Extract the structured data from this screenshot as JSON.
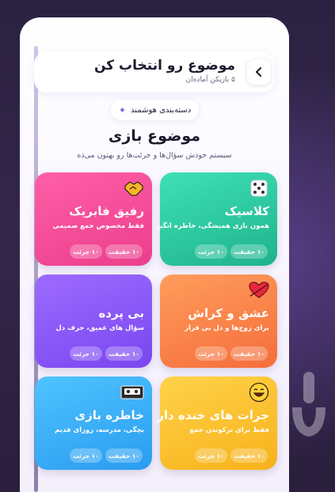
{
  "header": {
    "title": "موضوع رو انتخاب کن",
    "subtitle": "۵ بازیکن آماده‌ان"
  },
  "smart_category": {
    "label": "دسته‌بندی هوشمند"
  },
  "section": {
    "title": "موضوع بازی",
    "subtitle": "سیستم خودش سؤال‌ها و جرئت‌ها رو بهتون می‌ده"
  },
  "cards": [
    {
      "title": "کلاسیک",
      "desc": "همون بازی همیشگی، خاطره انگیز",
      "truth": "۱۰ حقیقت",
      "dare": "۱۰ جرئت",
      "icon": "dice-icon",
      "color_from": "#3fe0b5",
      "color_to": "#1fb38d"
    },
    {
      "title": "رفیق فابریک",
      "desc": "فقط مخصوص جمع صمیمی",
      "truth": "۱۰ حقیقت",
      "dare": "۱۰ جرئت",
      "icon": "handshake-icon",
      "color_from": "#ff5fa8",
      "color_to": "#ec3e8c"
    },
    {
      "title": "عشق و کراش",
      "desc": "برای زوج‌ها و دل بی قرار",
      "truth": "۱۰ حقیقت",
      "dare": "۱۰ جرئت",
      "icon": "heart-icon",
      "color_from": "#ff9d5c",
      "color_to": "#f56d3b"
    },
    {
      "title": "بی پرده",
      "desc": "سؤال های عمیق، حرف دل",
      "truth": "۱۰ حقیقت",
      "dare": "۱۰ جرئت",
      "icon": "none",
      "color_from": "#9d6bff",
      "color_to": "#7a46f0"
    },
    {
      "title": "جرات های خنده دار",
      "desc": "فقط برای ترکوندن جمع",
      "truth": "۱۰ حقیقت",
      "dare": "۱۰ جرئت",
      "icon": "laughing-face-icon",
      "color_from": "#ffd24a",
      "color_to": "#f7b21a"
    },
    {
      "title": "خاطره بازی",
      "desc": "بچگی، مدرسه، روزای قدیم",
      "truth": "۱۰ حقیقت",
      "dare": "۱۰ جرئت",
      "icon": "cassette-icon",
      "color_from": "#4fc3ff",
      "color_to": "#2a9cf0"
    }
  ]
}
